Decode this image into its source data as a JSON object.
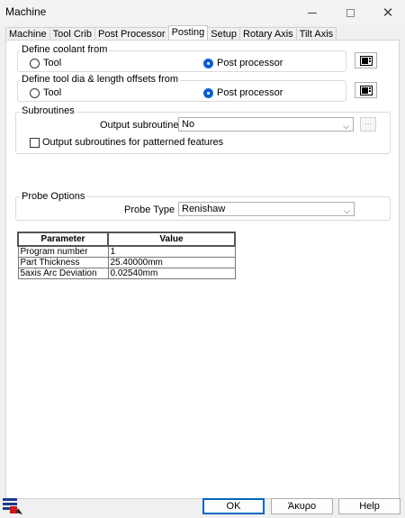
{
  "window": {
    "title": "Machine",
    "minimize_icon": "minimize-icon",
    "maximize_icon": "maximize-icon",
    "close_icon": "close-icon"
  },
  "tabs": [
    "Machine",
    "Tool Crib",
    "Post Processor",
    "Posting",
    "Setup",
    "Rotary Axis",
    "Tilt Axis"
  ],
  "active_tab": "Posting",
  "coolant": {
    "title": "Define coolant from",
    "option_tool": "Tool",
    "option_post": "Post processor",
    "selected": "Post processor"
  },
  "offsets": {
    "title": "Define tool dia & length offsets from",
    "option_tool": "Tool",
    "option_post": "Post processor",
    "selected": "Post processor"
  },
  "subroutines": {
    "title": "Subroutines",
    "output_label": "Output subroutines :",
    "output_value": "No",
    "more_button": "...",
    "patterned_label": "Output subroutines for patterned features",
    "patterned_checked": false
  },
  "probe": {
    "title": "Probe Options",
    "type_label": "Probe Type :",
    "type_value": "Renishaw"
  },
  "param_table": {
    "headers": [
      "Parameter",
      "Value"
    ],
    "rows": [
      [
        "Program number",
        "1"
      ],
      [
        "Part Thickness",
        "25.40000mm"
      ],
      [
        "5axis Arc Deviation",
        "0.02540mm"
      ]
    ]
  },
  "footer": {
    "ok": "OK",
    "cancel": "Άκυρο",
    "help": "Help"
  },
  "colors": {
    "accent": "#0067c0",
    "radio_selected": "#0b5cd6"
  }
}
